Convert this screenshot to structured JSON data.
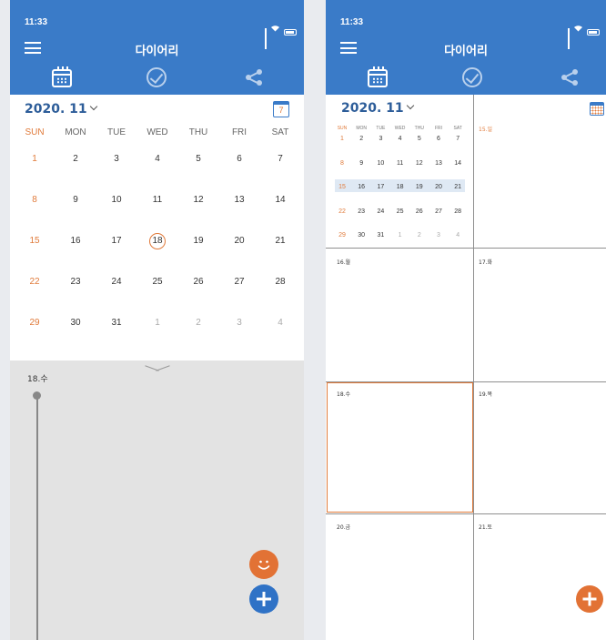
{
  "status": {
    "time": "11:33"
  },
  "app": {
    "title": "다이어리"
  },
  "calendar": {
    "month_label": "2020. 11",
    "today_badge": "7",
    "weekdays": [
      "SUN",
      "MON",
      "TUE",
      "WED",
      "THU",
      "FRI",
      "SAT"
    ],
    "weeks": [
      [
        "1",
        "2",
        "3",
        "4",
        "5",
        "6",
        "7"
      ],
      [
        "8",
        "9",
        "10",
        "11",
        "12",
        "13",
        "14"
      ],
      [
        "15",
        "16",
        "17",
        "18",
        "19",
        "20",
        "21"
      ],
      [
        "22",
        "23",
        "24",
        "25",
        "26",
        "27",
        "28"
      ],
      [
        "29",
        "30",
        "31",
        "1",
        "2",
        "3",
        "4"
      ]
    ],
    "selected_day": "18"
  },
  "timeline": {
    "date_label": "18.수"
  },
  "weekly": {
    "cells": [
      "15.일",
      "16.월",
      "17.화",
      "18.수",
      "19.목",
      "20.금",
      "21.토"
    ],
    "highlighted_week_index": 2
  },
  "colors": {
    "appbar": "#3a7bc8",
    "accent_orange": "#e27235",
    "fab_blue": "#2f72c6",
    "sunday": "#e07a3a",
    "month_text": "#2d5d99"
  }
}
